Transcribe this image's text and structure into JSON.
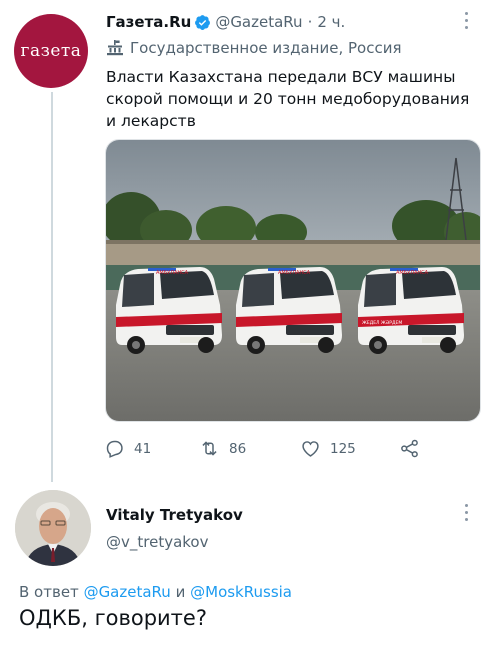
{
  "tweet": {
    "author_name": "Газета.Ru",
    "handle": "@GazetaRu",
    "separator": "·",
    "time": "2 ч.",
    "avatar_text": "газета",
    "label": "Государственное издание, Россия",
    "text": "Власти Казахстана передали ВСУ машины скорой помощи и 20 тонн медоборудования и лекарств",
    "media": {
      "vehicle_label": "АМБУЛАНСА",
      "side_label": "ЖЕДЕЛ ЖӘРДЕМ"
    },
    "actions": {
      "replies": "41",
      "retweets": "86",
      "likes": "125"
    },
    "icons": [
      "verified-badge-icon",
      "government-building-icon",
      "reply-icon",
      "retweet-icon",
      "like-icon",
      "share-icon",
      "more-icon"
    ]
  },
  "reply": {
    "author_name": "Vitaly Tretyakov",
    "handle": "@v_tretyakov",
    "replying_prefix": "В ответ",
    "mention1": "@GazetaRu",
    "conjunction": "и",
    "mention2": "@MoskRussia",
    "text": "ОДКБ, говорите?"
  },
  "colors": {
    "brand_avatar": "#a3163f",
    "verified": "#1d9bf0",
    "link": "#1d9bf0",
    "muted": "#536471"
  }
}
